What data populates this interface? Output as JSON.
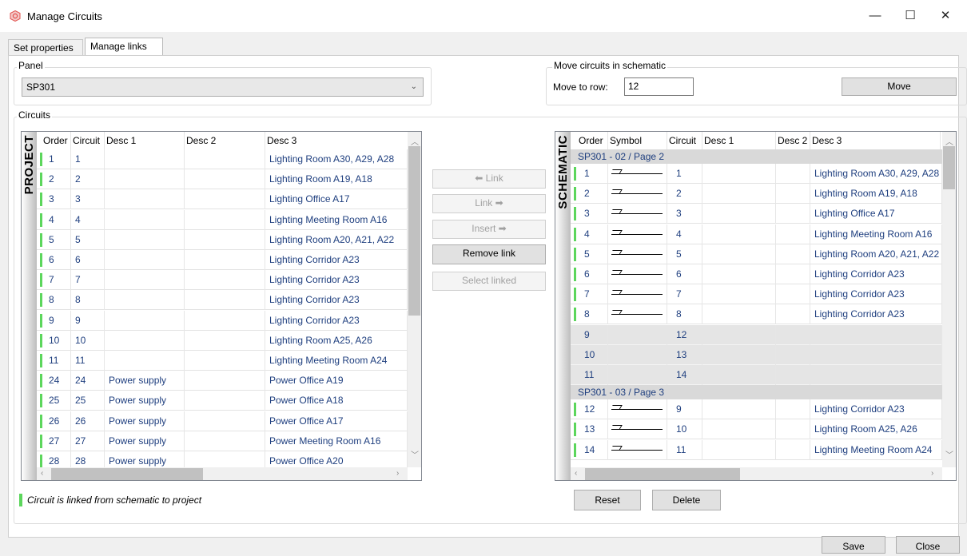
{
  "window": {
    "title": "Manage Circuits",
    "minimize": "—",
    "maximize": "☐",
    "close": "✕"
  },
  "tabs": [
    {
      "label": "Set properties"
    },
    {
      "label": "Manage links"
    }
  ],
  "panel": {
    "label": "Panel",
    "value": "SP301"
  },
  "move": {
    "label": "Move circuits in schematic",
    "row_label": "Move to row:",
    "row_value": "12",
    "button": "Move"
  },
  "circuits_label": "Circuits",
  "project": {
    "title": "PROJECT",
    "headers": [
      "Order",
      "Circuit",
      "Desc 1",
      "Desc 2",
      "Desc 3"
    ],
    "rows": [
      {
        "order": "1",
        "circuit": "1",
        "desc1": "",
        "desc2": "",
        "desc3": "Lighting Room A30, A29, A28",
        "linked": true
      },
      {
        "order": "2",
        "circuit": "2",
        "desc1": "",
        "desc2": "",
        "desc3": "Lighting Room A19, A18",
        "linked": true
      },
      {
        "order": "3",
        "circuit": "3",
        "desc1": "",
        "desc2": "",
        "desc3": "Lighting Office A17",
        "linked": true
      },
      {
        "order": "4",
        "circuit": "4",
        "desc1": "",
        "desc2": "",
        "desc3": "Lighting Meeting Room A16",
        "linked": true
      },
      {
        "order": "5",
        "circuit": "5",
        "desc1": "",
        "desc2": "",
        "desc3": "Lighting Room A20, A21, A22",
        "linked": true
      },
      {
        "order": "6",
        "circuit": "6",
        "desc1": "",
        "desc2": "",
        "desc3": "Lighting Corridor A23",
        "linked": true
      },
      {
        "order": "7",
        "circuit": "7",
        "desc1": "",
        "desc2": "",
        "desc3": "Lighting Corridor A23",
        "linked": true
      },
      {
        "order": "8",
        "circuit": "8",
        "desc1": "",
        "desc2": "",
        "desc3": "Lighting Corridor A23",
        "linked": true
      },
      {
        "order": "9",
        "circuit": "9",
        "desc1": "",
        "desc2": "",
        "desc3": "Lighting Corridor A23",
        "linked": true
      },
      {
        "order": "10",
        "circuit": "10",
        "desc1": "",
        "desc2": "",
        "desc3": "Lighting Room A25, A26",
        "linked": true
      },
      {
        "order": "11",
        "circuit": "11",
        "desc1": "",
        "desc2": "",
        "desc3": "Lighting Meeting Room A24",
        "linked": true
      },
      {
        "order": "24",
        "circuit": "24",
        "desc1": "Power supply",
        "desc2": "",
        "desc3": "Power Office A19",
        "linked": true
      },
      {
        "order": "25",
        "circuit": "25",
        "desc1": "Power supply",
        "desc2": "",
        "desc3": "Power Office A18",
        "linked": true
      },
      {
        "order": "26",
        "circuit": "26",
        "desc1": "Power supply",
        "desc2": "",
        "desc3": "Power Office A17",
        "linked": true
      },
      {
        "order": "27",
        "circuit": "27",
        "desc1": "Power supply",
        "desc2": "",
        "desc3": "Power Meeting Room A16",
        "linked": true
      },
      {
        "order": "28",
        "circuit": "28",
        "desc1": "Power supply",
        "desc2": "",
        "desc3": "Power Office A20",
        "linked": true
      }
    ]
  },
  "middle_buttons": {
    "link_left": "⬅ Link",
    "link_right": "Link ➡",
    "insert": "Insert ➡",
    "remove_link": "Remove link",
    "select_linked": "Select linked"
  },
  "schematic": {
    "title": "SCHEMATIC",
    "headers": [
      "Order",
      "Symbol",
      "Circuit",
      "Desc 1",
      "Desc 2",
      "Desc 3"
    ],
    "groups": [
      {
        "title": "SP301 - 02 / Page 2",
        "rows": [
          {
            "order": "1",
            "circuit": "1",
            "desc3": "Lighting Room A30, A29, A28",
            "linked": true,
            "symbol": "switch-symbol"
          },
          {
            "order": "2",
            "circuit": "2",
            "desc3": "Lighting Room A19, A18",
            "linked": true,
            "symbol": "switch-symbol"
          },
          {
            "order": "3",
            "circuit": "3",
            "desc3": "Lighting Office A17",
            "linked": true,
            "symbol": "switch-symbol"
          },
          {
            "order": "4",
            "circuit": "4",
            "desc3": "Lighting Meeting Room A16",
            "linked": true,
            "symbol": "switch-symbol"
          },
          {
            "order": "5",
            "circuit": "5",
            "desc3": "Lighting Room A20, A21, A22",
            "linked": true,
            "symbol": "switch-symbol"
          },
          {
            "order": "6",
            "circuit": "6",
            "desc3": "Lighting Corridor A23",
            "linked": true,
            "symbol": "switch-symbol"
          },
          {
            "order": "7",
            "circuit": "7",
            "desc3": "Lighting Corridor A23",
            "linked": true,
            "symbol": "switch-symbol"
          },
          {
            "order": "8",
            "circuit": "8",
            "desc3": "Lighting Corridor A23",
            "linked": true,
            "symbol": "switch-symbol"
          },
          {
            "order": "9",
            "circuit": "12",
            "desc3": "",
            "linked": false,
            "symbol": ""
          },
          {
            "order": "10",
            "circuit": "13",
            "desc3": "",
            "linked": false,
            "symbol": ""
          },
          {
            "order": "11",
            "circuit": "14",
            "desc3": "",
            "linked": false,
            "symbol": ""
          }
        ]
      },
      {
        "title": "SP301 - 03 / Page 3",
        "rows": [
          {
            "order": "12",
            "circuit": "9",
            "desc3": "Lighting Corridor A23",
            "linked": true,
            "symbol": "switch-symbol"
          },
          {
            "order": "13",
            "circuit": "10",
            "desc3": "Lighting Room A25, A26",
            "linked": true,
            "symbol": "switch-symbol"
          },
          {
            "order": "14",
            "circuit": "11",
            "desc3": "Lighting Meeting Room A24",
            "linked": true,
            "symbol": "switch-symbol"
          }
        ]
      }
    ]
  },
  "actions": {
    "reset": "Reset",
    "delete": "Delete",
    "save": "Save",
    "close": "Close"
  },
  "legend": {
    "text": "Circuit is linked from schematic to project",
    "color": "#5cd65c"
  },
  "colors": {
    "link_text": "#1f3f7f",
    "brand": "#e2504c"
  }
}
